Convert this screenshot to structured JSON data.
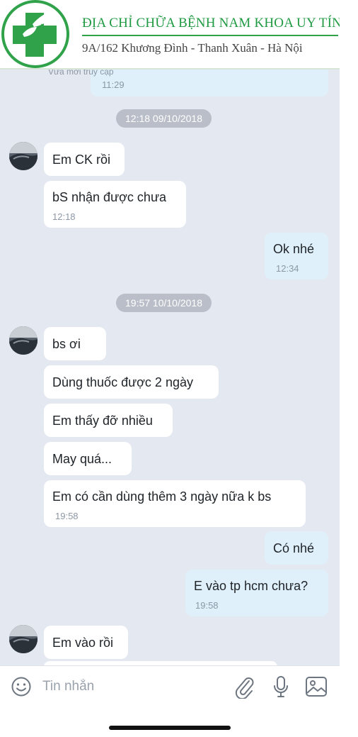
{
  "banner": {
    "title": "ĐỊA CHỈ CHỮA BỆNH NAM KHOA UY TÍN",
    "address": "9A/162 Khương Đình - Thanh Xuân - Hà Nội",
    "brand_color": "#2fa24a"
  },
  "top_peek": {
    "status": "Vừa mới truy cập",
    "time": "11:29"
  },
  "date_separators": [
    "12:18 09/10/2018",
    "19:57 10/10/2018"
  ],
  "messages": [
    {
      "from": "contact",
      "text": "Em CK rồi",
      "time": ""
    },
    {
      "from": "contact",
      "text": "bS nhận được chưa",
      "time": "12:18"
    },
    {
      "from": "me",
      "text": "Ok nhé",
      "time": "12:34"
    },
    {
      "from": "contact",
      "text": "bs ơi",
      "time": ""
    },
    {
      "from": "contact",
      "text": "Dùng thuốc được 2 ngày",
      "time": ""
    },
    {
      "from": "contact",
      "text": "Em thấy đỡ nhiều",
      "time": ""
    },
    {
      "from": "contact",
      "text": "May quá...",
      "time": ""
    },
    {
      "from": "contact",
      "text": "Em có cần dùng thêm 3 ngày nữa k bs",
      "time": "19:58"
    },
    {
      "from": "me",
      "text": "Có nhé",
      "time": ""
    },
    {
      "from": "me",
      "text": "E vào tp hcm chưa?",
      "time": "19:58"
    },
    {
      "from": "contact",
      "text": "Em vào rồi",
      "time": ""
    }
  ],
  "composer": {
    "placeholder": "Tin nhắn",
    "icons": [
      "emoji-icon",
      "attachment-icon",
      "microphone-icon",
      "image-icon"
    ]
  },
  "colors": {
    "chat_background": "#e4e8f0",
    "incoming_bubble": "#ffffff",
    "outgoing_bubble": "#dff0fb",
    "date_chip": "#b9bec8"
  }
}
